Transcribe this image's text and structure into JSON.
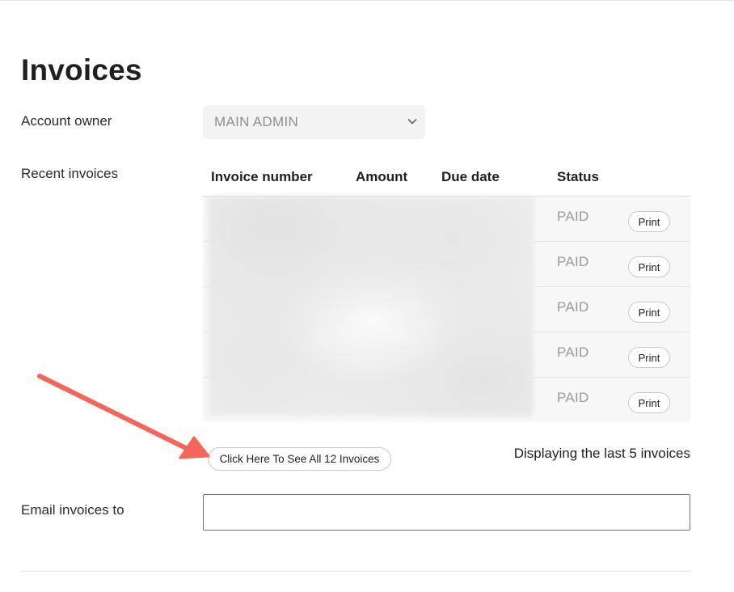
{
  "page": {
    "title": "Invoices"
  },
  "account_owner": {
    "label": "Account owner",
    "selected": "MAIN ADMIN",
    "icon": "chevron-down-icon"
  },
  "recent_invoices": {
    "label": "Recent invoices",
    "columns": [
      "Invoice number",
      "Amount",
      "Due date",
      "Status"
    ],
    "rows": [
      {
        "status": "PAID",
        "action": "Print"
      },
      {
        "status": "PAID",
        "action": "Print"
      },
      {
        "status": "PAID",
        "action": "Print"
      },
      {
        "status": "PAID",
        "action": "Print"
      },
      {
        "status": "PAID",
        "action": "Print"
      }
    ],
    "see_all_button": "Click Here To See All 12 Invoices",
    "displaying_text": "Displaying the last 5 invoices"
  },
  "email": {
    "label": "Email invoices to",
    "value": ""
  },
  "colors": {
    "annotation_arrow": "#f4665a",
    "status_text": "#9a9a9f",
    "row_background": "#f7f7f7"
  }
}
